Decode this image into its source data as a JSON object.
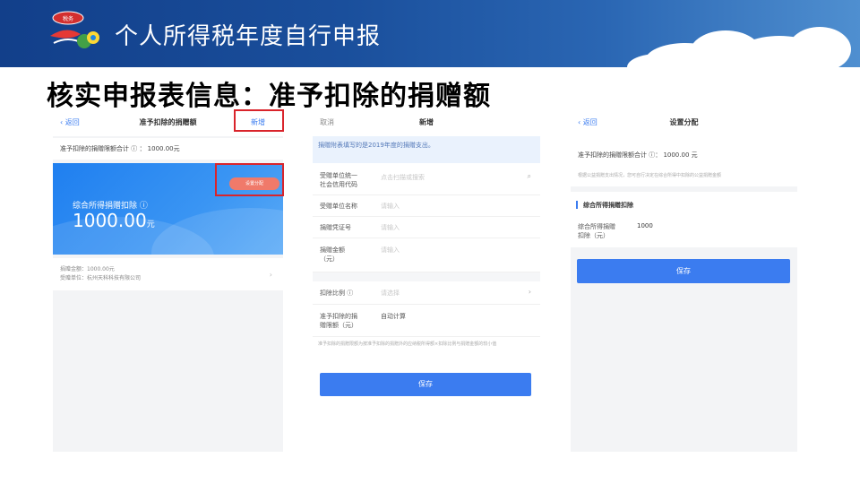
{
  "banner": {
    "title": "个人所得税年度自行申报",
    "logo_text": "税务"
  },
  "page_title": "核实申报表信息：准予扣除的捐赠额",
  "phone1": {
    "nav": {
      "back": "返回",
      "title": "准予扣除的捐赠额",
      "action": "新增"
    },
    "summary": "准予扣除的捐赠限额合计 ⓘ ：  1000.00元",
    "pill": "设置分配",
    "card": {
      "label": "综合所得捐赠扣除 ⓘ",
      "amount": "1000.00",
      "unit": "元"
    },
    "detail": {
      "line1": "捐赠金额：1000.00元",
      "line2": "受赠单位：杭州天科科技有限公司"
    }
  },
  "phone2": {
    "nav": {
      "cancel": "取消",
      "title": "新增"
    },
    "notice": "捐赠附表填写的是2019年度的捐赠支出。",
    "rows": [
      {
        "label1": "受赠单位统一",
        "label2": "社会信用代码",
        "value": "点击扫描或搜索"
      },
      {
        "label1": "受赠单位名称",
        "label2": "",
        "value": "请输入"
      },
      {
        "label1": "捐赠凭证号",
        "label2": "",
        "value": "请输入"
      },
      {
        "label1": "捐赠金额",
        "label2": "（元）",
        "value": "请输入"
      },
      {
        "label1": "扣除比例 ⓘ",
        "label2": "",
        "value": "请选择"
      },
      {
        "label1": "准予扣除的捐",
        "label2": "赠限额（元）",
        "value": "自动计算"
      }
    ],
    "footnote": "准予扣除的捐赠限额为按准予扣除的捐赠外的应纳税所得额×扣除比例与捐赠金额的较小值",
    "save": "保存"
  },
  "phone3": {
    "nav": {
      "back": "返回",
      "title": "设置分配"
    },
    "limit": "准予扣除的捐赠限额合计 ⓘ：    1000.00 元",
    "hint": "根据公益捐赠支出情况，您可自行决定在综合所得中扣除的公益捐赠金额",
    "section_title": "综合所得捐赠扣除",
    "row_label1": "综合所得捐赠",
    "row_label2": "扣除（元）",
    "row_value": "1000",
    "save": "保存"
  },
  "colors": {
    "banner": "#1a4f9c",
    "accent": "#3b7cf0",
    "highlight": "#d9242b"
  }
}
